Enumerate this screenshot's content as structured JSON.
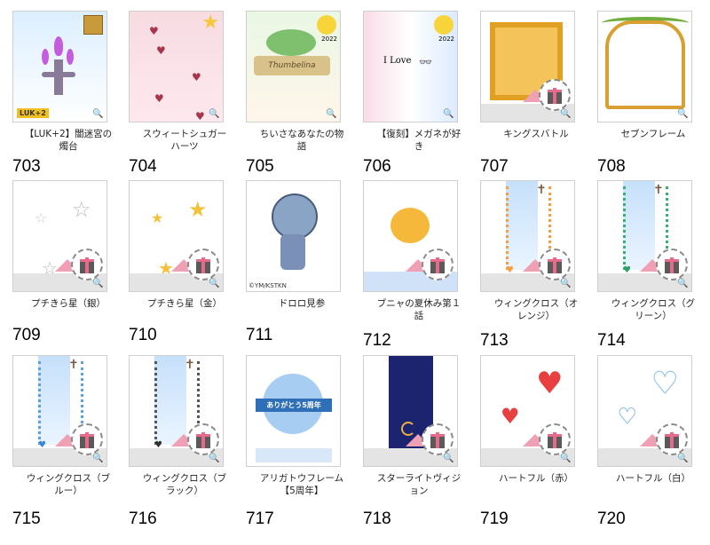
{
  "items": [
    {
      "label": "【LUK+2】闇迷宮の\n燭台",
      "num": "703",
      "badge_text": "LUK+2"
    },
    {
      "label": "スウィートシュガー\nハーツ",
      "num": "704"
    },
    {
      "label": "ちいさなあなたの物\n語",
      "num": "705",
      "banner_text": "Thumbelina",
      "year": "2022"
    },
    {
      "label": "【復刻】メガネが好\nき",
      "num": "706",
      "thumb_text": "I Love",
      "year": "2022"
    },
    {
      "label": "キングスバトル",
      "num": "707"
    },
    {
      "label": "セブンフレーム",
      "num": "708"
    },
    {
      "label": "プチきら星（銀）",
      "num": "709"
    },
    {
      "label": "プチきら星（金）",
      "num": "710"
    },
    {
      "label": "ドロロ見参",
      "num": "711",
      "copyright": "©YM/KSTKN"
    },
    {
      "label": "ブニャの夏休み第１\n話",
      "num": "712"
    },
    {
      "label": "ウィングクロス（オ\nレンジ）",
      "num": "713"
    },
    {
      "label": "ウィングクロス（グ\nリーン）",
      "num": "714"
    },
    {
      "label": "ウィングクロス（ブ\nルー）",
      "num": "715"
    },
    {
      "label": "ウィングクロス（ブ\nラック）",
      "num": "716"
    },
    {
      "label": "アリガトウフレーム\n【5周年】",
      "num": "717",
      "thumb_text": "ありがとう5周年"
    },
    {
      "label": "スターライトヴィジ\nョン",
      "num": "718"
    },
    {
      "label": "ハートフル（赤）",
      "num": "719"
    },
    {
      "label": "ハートフル（白）",
      "num": "720"
    }
  ],
  "zoom_icon": "magnify-plus-icon",
  "gift_icon": "gift-icon"
}
